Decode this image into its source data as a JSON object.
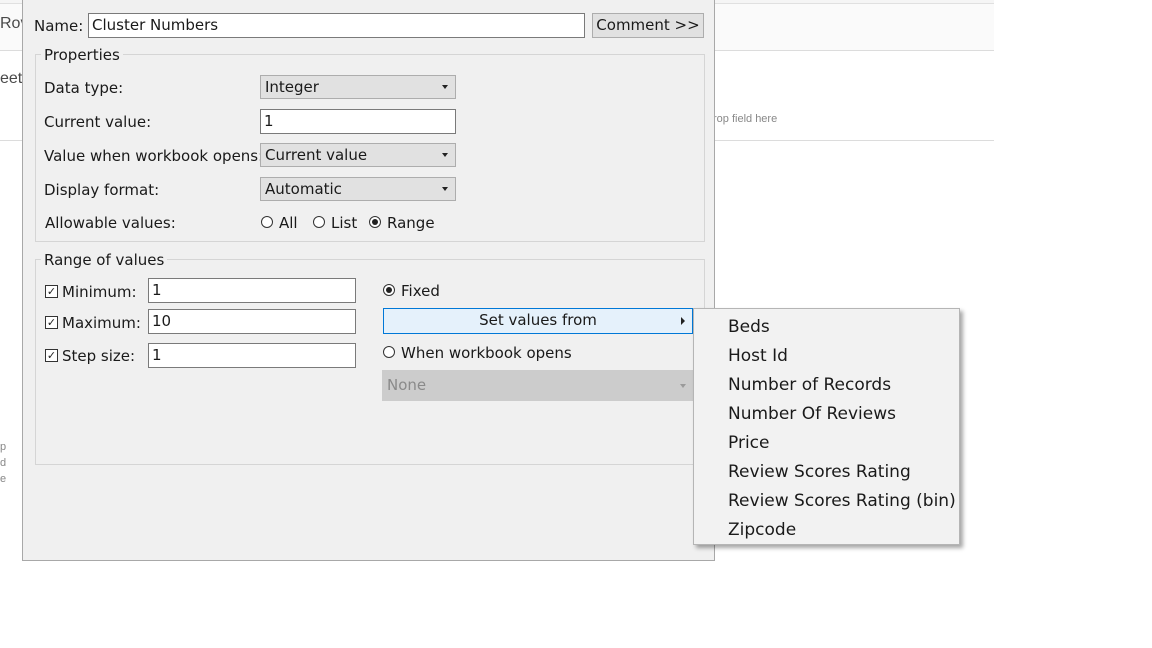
{
  "background": {
    "rows_label": "Rov",
    "sheet_label": "eet",
    "drop_hint": "rop field here",
    "side_letters": [
      "p",
      "d",
      "e"
    ]
  },
  "dialog": {
    "name_label": "Name:",
    "name_value": "Cluster Numbers",
    "comment_button": "Comment >>",
    "properties": {
      "title": "Properties",
      "data_type_label": "Data type:",
      "data_type_value": "Integer",
      "current_value_label": "Current value:",
      "current_value": "1",
      "workbook_opens_label": "Value when workbook opens:",
      "workbook_opens_value": "Current value",
      "display_format_label": "Display format:",
      "display_format_value": "Automatic",
      "allowable_label": "Allowable values:",
      "allowable_options": [
        "All",
        "List",
        "Range"
      ],
      "allowable_selected": "Range"
    },
    "range": {
      "title": "Range of values",
      "minimum_label": "Minimum:",
      "minimum_value": "1",
      "minimum_checked": true,
      "maximum_label": "Maximum:",
      "maximum_value": "10",
      "maximum_checked": true,
      "step_label": "Step size:",
      "step_value": "1",
      "step_checked": true,
      "fixed_label": "Fixed",
      "fixed_selected": true,
      "set_values_button": "Set values from",
      "when_opens_label": "When workbook opens",
      "when_opens_selected": false,
      "source_select_value": "None"
    }
  },
  "context_menu": {
    "items": [
      "Beds",
      "Host Id",
      "Number of Records",
      "Number Of Reviews",
      "Price",
      "Review Scores Rating",
      "Review Scores Rating (bin)",
      "Zipcode"
    ]
  }
}
